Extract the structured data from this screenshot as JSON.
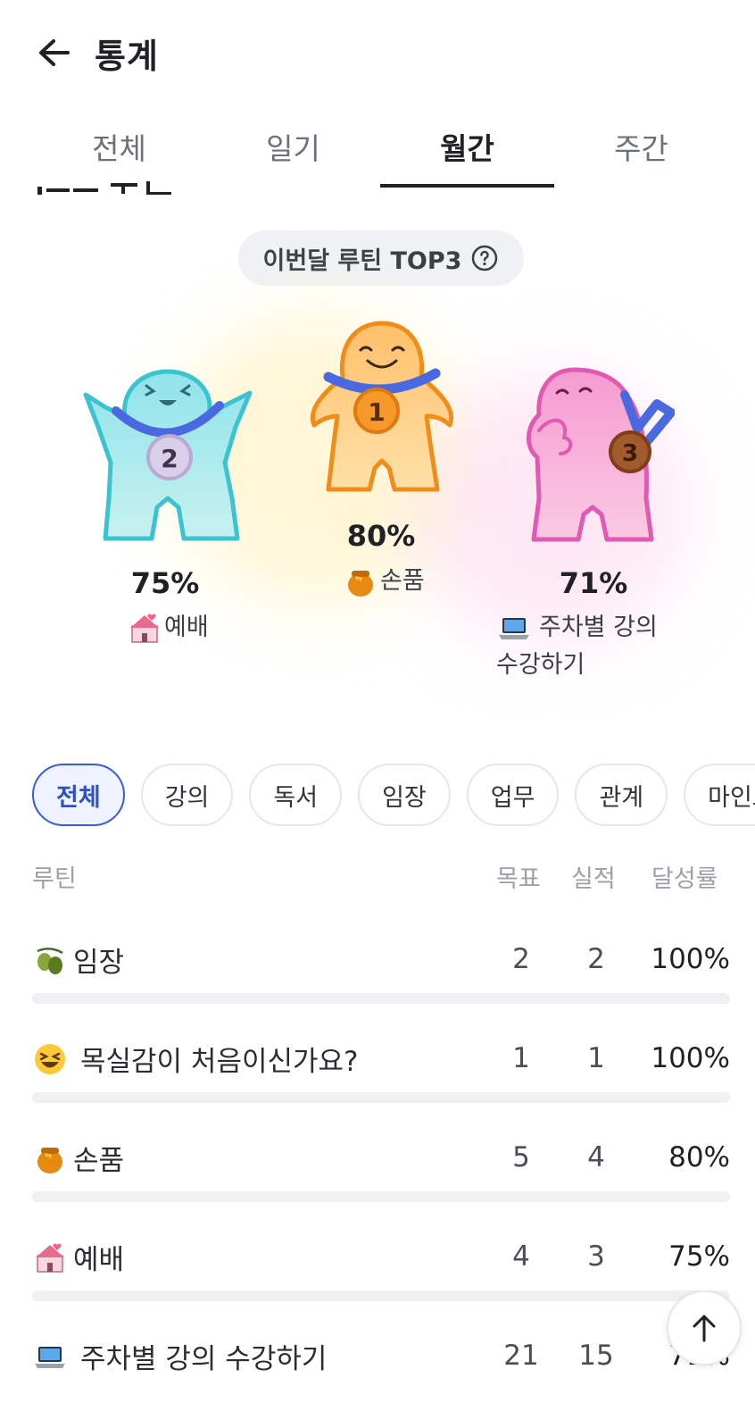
{
  "header": {
    "title": "통계",
    "back_icon": "arrow-left-icon"
  },
  "tabs": [
    {
      "label": "전체",
      "active": false
    },
    {
      "label": "일기",
      "active": false
    },
    {
      "label": "월간",
      "active": true
    },
    {
      "label": "주간",
      "active": false
    }
  ],
  "top3": {
    "pill_label": "이번달 루틴 TOP3",
    "help_icon": "question-circle-icon",
    "first": {
      "rank": "1",
      "percent": "80%",
      "icon": "honey-pot-icon",
      "name": "손품"
    },
    "second": {
      "rank": "2",
      "percent": "75%",
      "icon": "church-icon",
      "name": "예배"
    },
    "third": {
      "rank": "3",
      "percent": "71%",
      "icon": "laptop-icon",
      "name_line1": "주차별 강의",
      "name_line2": "수강하기"
    }
  },
  "categories": {
    "selected": "전체",
    "items": [
      "전체",
      "강의",
      "독서",
      "임장",
      "업무",
      "관계",
      "마인드"
    ]
  },
  "table": {
    "headers": {
      "routine": "루틴",
      "goal": "목표",
      "done": "실적",
      "rate": "달성률"
    },
    "rows": [
      {
        "icon": "olive-icon",
        "name": "임장",
        "goal": "2",
        "done": "2",
        "rate": "100%",
        "progress": 1.0
      },
      {
        "icon": "laughing-face-icon",
        "name": "목실감이 처음이신가요?",
        "goal": "1",
        "done": "1",
        "rate": "100%",
        "progress": 1.0
      },
      {
        "icon": "honey-pot-icon",
        "name": "손품",
        "goal": "5",
        "done": "4",
        "rate": "80%",
        "progress": 0.8
      },
      {
        "icon": "church-icon",
        "name": "예배",
        "goal": "4",
        "done": "3",
        "rate": "75%",
        "progress": 0.75
      },
      {
        "icon": "laptop-icon",
        "name": "주차별 강의 수강하기",
        "goal": "21",
        "done": "15",
        "rate": "71%",
        "progress": 0.71
      }
    ]
  },
  "scroll_top_icon": "arrow-up-icon",
  "colors": {
    "accent": "#3b5bdb",
    "gold": "#f5a03a",
    "silver_figure": "#8fe3ea",
    "bronze_figure": "#f59bd0",
    "medal_ribbon": "#4a68e0"
  }
}
